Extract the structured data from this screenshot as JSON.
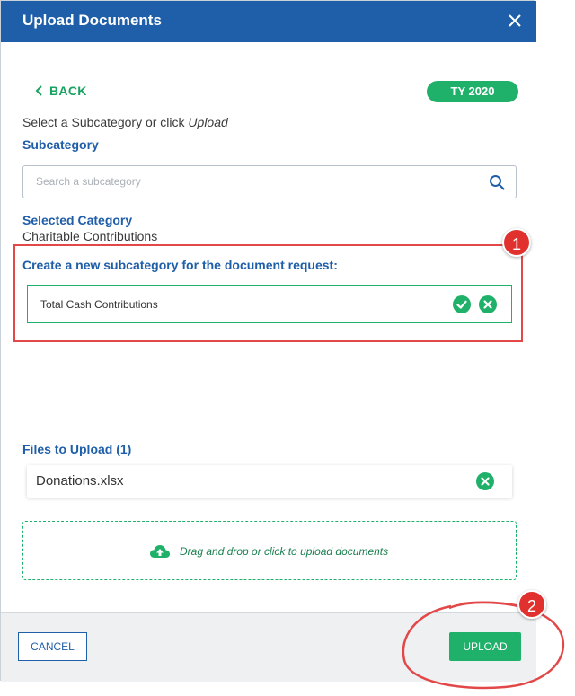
{
  "dialog": {
    "title": "Upload Documents",
    "back_label": "BACK",
    "tax_year_badge": "TY 2020",
    "instruction_prefix": "Select a Subcategory or click ",
    "instruction_emphasis": "Upload",
    "subcategory_label": "Subcategory",
    "search": {
      "placeholder": "Search a subcategory",
      "value": ""
    },
    "selected_category_label": "Selected Category",
    "selected_category_value": "Charitable Contributions",
    "new_subcategory_label": "Create a new subcategory for the document request:",
    "new_subcategory_value": "Total Cash Contributions",
    "files_label": "Files to Upload (1)",
    "files": [
      {
        "name": "Donations.xlsx"
      }
    ],
    "dropzone_text": "Drag and drop or click to upload documents",
    "cancel_label": "CANCEL",
    "upload_label": "UPLOAD"
  },
  "annotations": {
    "callout_1": "1",
    "callout_2": "2"
  },
  "colors": {
    "header_blue": "#1f5ea8",
    "accent_green": "#1fb169",
    "highlight_red": "#e24848"
  },
  "icons": [
    "close-icon",
    "chevron-left-icon",
    "search-icon",
    "check-circle-icon",
    "x-circle-icon",
    "cloud-upload-icon"
  ]
}
